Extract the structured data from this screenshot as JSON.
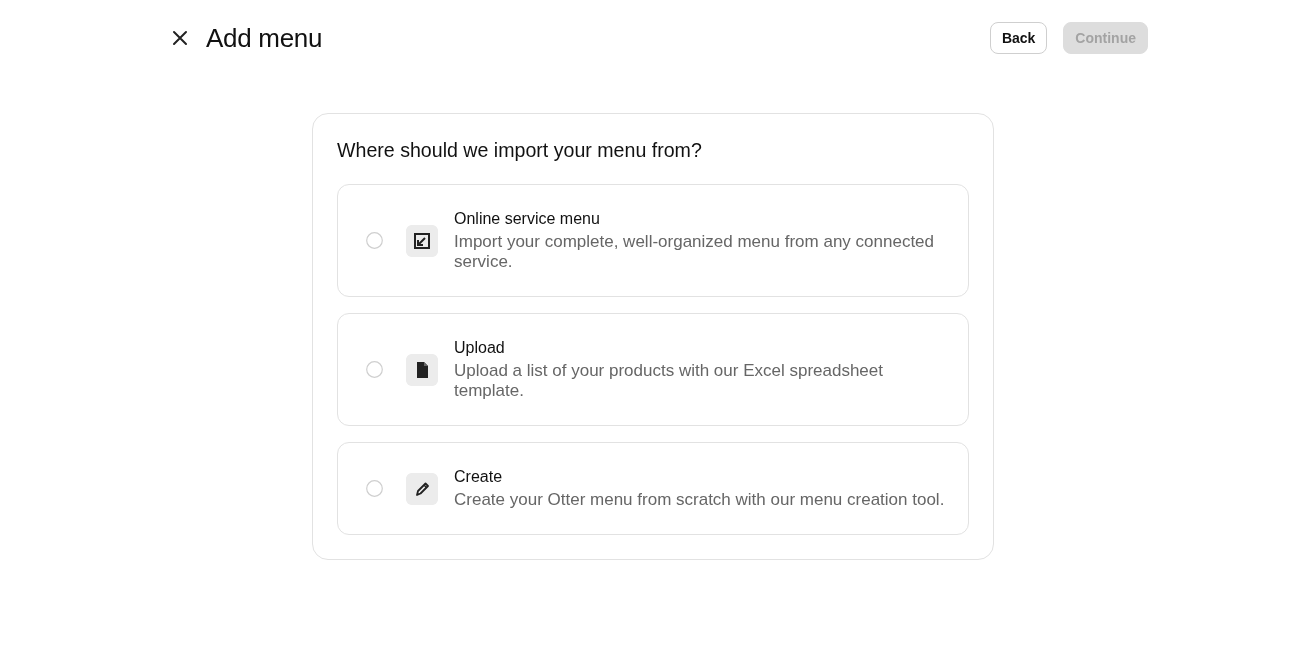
{
  "header": {
    "title": "Add menu",
    "buttons": [
      {
        "kind": "outline",
        "label": "Back",
        "disabled": false
      },
      {
        "kind": "primary",
        "label": "Continue",
        "disabled": true
      }
    ]
  },
  "card": {
    "heading": "Where should we import your menu from?",
    "options": [
      {
        "kind": "import",
        "title": "Online service menu",
        "description": "Import your complete, well-organized menu from any connected service.",
        "selected": false
      },
      {
        "kind": "file",
        "title": "Upload",
        "description": "Upload a list of your products with our Excel spreadsheet template.",
        "selected": false
      },
      {
        "kind": "pencil",
        "title": "Create",
        "description": "Create your Otter menu from scratch with our menu creation tool.",
        "selected": false
      }
    ]
  }
}
